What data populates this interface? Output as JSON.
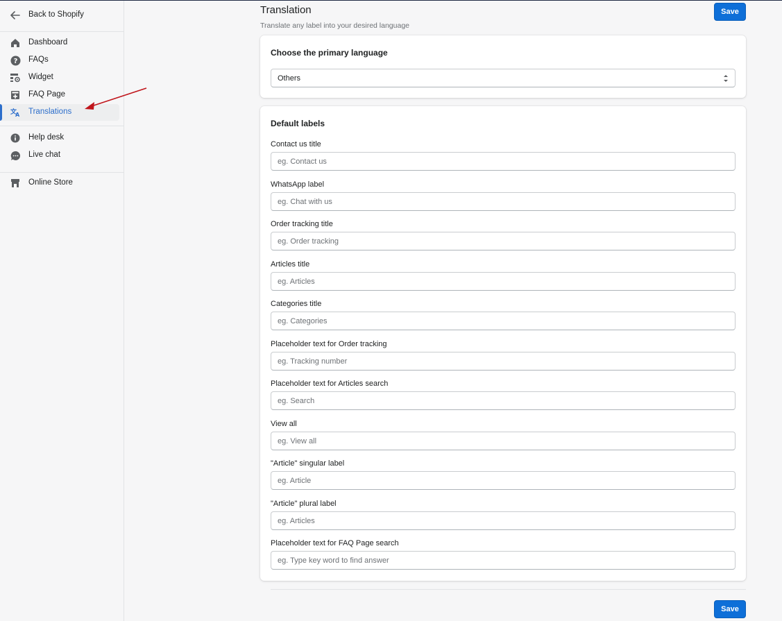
{
  "sidebar": {
    "back_label": "Back to Shopify",
    "items": [
      {
        "label": "Dashboard",
        "icon": "home-icon"
      },
      {
        "label": "FAQs",
        "icon": "question-circle-icon"
      },
      {
        "label": "Widget",
        "icon": "widget-settings-icon"
      },
      {
        "label": "FAQ Page",
        "icon": "add-page-icon"
      },
      {
        "label": "Translations",
        "icon": "translate-icon",
        "active": true
      }
    ],
    "support_items": [
      {
        "label": "Help desk",
        "icon": "info-circle-icon"
      },
      {
        "label": "Live chat",
        "icon": "chat-bubble-icon"
      }
    ],
    "store_items": [
      {
        "label": "Online Store",
        "icon": "store-icon"
      }
    ]
  },
  "header": {
    "title": "Translation",
    "subtitle": "Translate any label into your desired language",
    "save_label": "Save"
  },
  "language_card": {
    "title": "Choose the primary language",
    "selected": "Others"
  },
  "labels_card": {
    "title": "Default labels",
    "fields": [
      {
        "label": "Contact us title",
        "placeholder": "eg. Contact us"
      },
      {
        "label": "WhatsApp label",
        "placeholder": "eg. Chat with us"
      },
      {
        "label": "Order tracking title",
        "placeholder": "eg. Order tracking"
      },
      {
        "label": "Articles title",
        "placeholder": "eg. Articles"
      },
      {
        "label": "Categories title",
        "placeholder": "eg. Categories"
      },
      {
        "label": "Placeholder text for Order tracking",
        "placeholder": "eg. Tracking number"
      },
      {
        "label": "Placeholder text for Articles search",
        "placeholder": "eg. Search"
      },
      {
        "label": "View all",
        "placeholder": "eg. View all"
      },
      {
        "label": "\"Article\" singular label",
        "placeholder": "eg. Article"
      },
      {
        "label": "\"Article\" plural label",
        "placeholder": "eg. Articles"
      },
      {
        "label": "Placeholder text for FAQ Page search",
        "placeholder": "eg. Type key word to find answer"
      }
    ]
  },
  "footer": {
    "save_label": "Save"
  },
  "colors": {
    "accent": "#2c6ecb",
    "primary_button": "#0e6fd8",
    "annotation_arrow": "#c0151b"
  }
}
